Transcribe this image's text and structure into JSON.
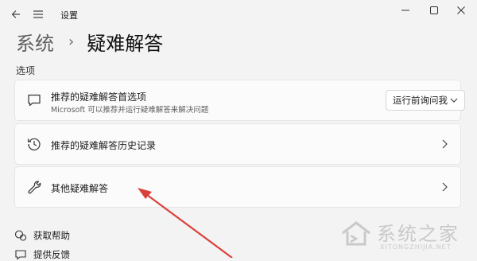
{
  "window": {
    "app_title": "设置",
    "back_icon": "back-arrow-icon",
    "menu_icon": "hamburger-menu-icon"
  },
  "breadcrumb": {
    "parent": "系统",
    "separator": "›",
    "current": "疑难解答"
  },
  "section": {
    "label": "选项"
  },
  "cards": [
    {
      "icon": "feedback-chat-icon",
      "title": "推荐的疑难解答首选项",
      "description": "Microsoft 可以推荐并运行疑难解答来解决问题",
      "dropdown_value": "运行前询问我"
    },
    {
      "icon": "history-icon",
      "title": "推荐的疑难解答历史记录"
    },
    {
      "icon": "wrench-icon",
      "title": "其他疑难解答"
    }
  ],
  "footer_links": [
    {
      "icon": "help-icon",
      "label": "获取帮助"
    },
    {
      "icon": "feedback-icon",
      "label": "提供反馈"
    }
  ],
  "watermark": {
    "text": "系统之家",
    "url": "XITONGZHIJIA.NET"
  },
  "colors": {
    "background": "#f3f3f3",
    "card": "#fbfbfb",
    "annotation_arrow": "#d9423a"
  }
}
